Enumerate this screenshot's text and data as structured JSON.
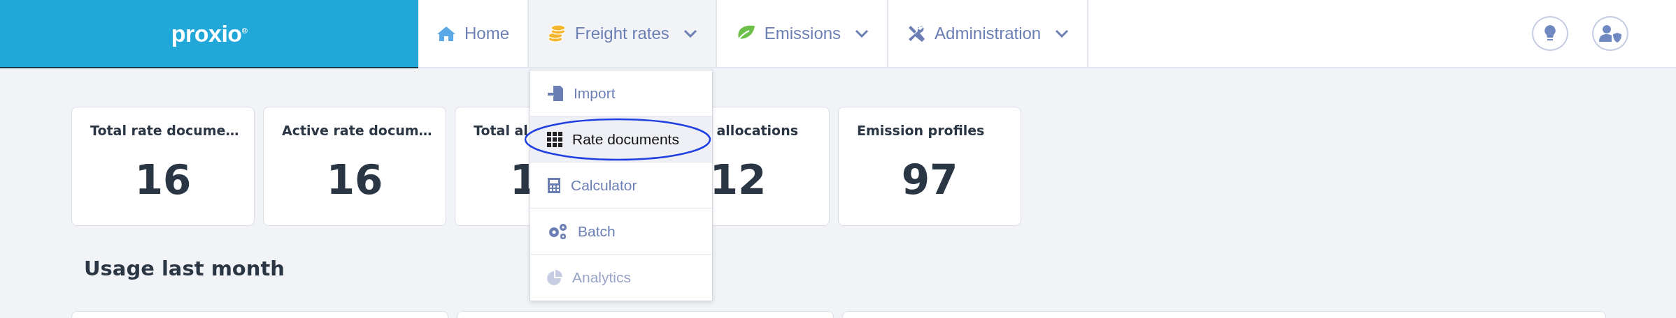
{
  "header": {
    "logo": "proxio",
    "logo_mark": "®",
    "nav": [
      {
        "label": "Home",
        "kind": "home",
        "selected": false,
        "dropdown": false
      },
      {
        "label": "Freight rates",
        "kind": "coins",
        "selected": true,
        "dropdown": true
      },
      {
        "label": "Emissions",
        "kind": "leaf",
        "selected": false,
        "dropdown": true
      },
      {
        "label": "Administration",
        "kind": "tools",
        "selected": false,
        "dropdown": true
      }
    ],
    "actions": [
      {
        "kind": "bulb"
      },
      {
        "kind": "user-shield"
      }
    ]
  },
  "menu": [
    {
      "label": "Import",
      "kind": "import",
      "selected": false,
      "disabled": false
    },
    {
      "label": "Rate documents",
      "kind": "grid",
      "selected": true,
      "disabled": false
    },
    {
      "label": "Calculator",
      "kind": "calculator",
      "selected": false,
      "disabled": false
    },
    {
      "label": "Batch",
      "kind": "gears",
      "selected": false,
      "disabled": false
    },
    {
      "label": "Analytics",
      "kind": "pie",
      "selected": false,
      "disabled": true
    }
  ],
  "stats": [
    {
      "title": "Total rate docume…",
      "value": "16",
      "kind": "full"
    },
    {
      "title": "Active rate docum…",
      "value": "16",
      "kind": "full"
    },
    {
      "title": "Total al",
      "value": "1",
      "kind": "cut-right"
    },
    {
      "title": "allocations",
      "value": "12",
      "kind": "cut-left"
    },
    {
      "title": "Emission profiles",
      "value": "97",
      "kind": "full"
    }
  ],
  "usage": {
    "heading": "Usage last month",
    "panels": [
      {
        "kind": "narrow"
      },
      {
        "kind": "narrow"
      },
      {
        "kind": "wide"
      }
    ]
  }
}
